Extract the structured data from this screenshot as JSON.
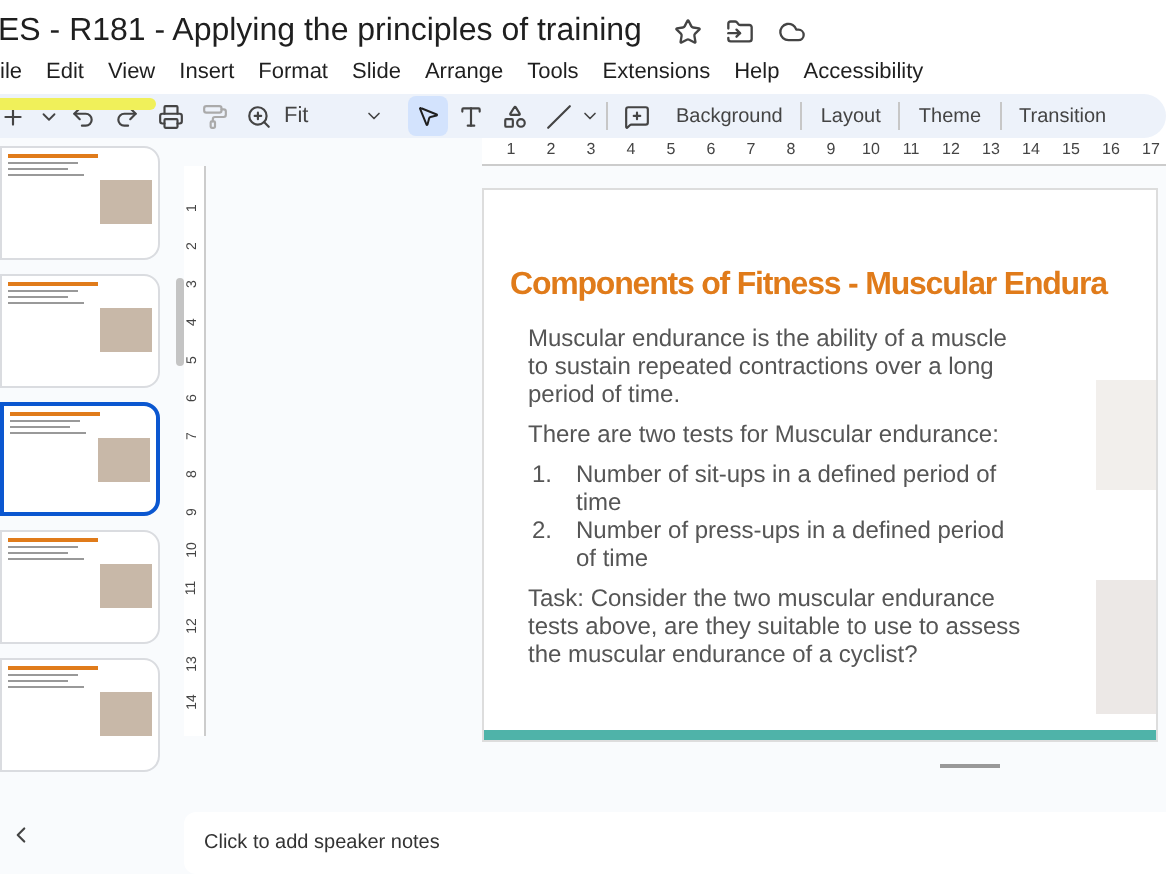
{
  "document": {
    "title": "ES - R181 - Applying the principles of training"
  },
  "menu": [
    "ile",
    "Edit",
    "View",
    "Insert",
    "Format",
    "Slide",
    "Arrange",
    "Tools",
    "Extensions",
    "Help",
    "Accessibility"
  ],
  "toolbar": {
    "zoom": "Fit",
    "buttons": [
      "Background",
      "Layout",
      "Theme",
      "Transition"
    ]
  },
  "thumbnails": [
    {
      "selected": false
    },
    {
      "selected": false
    },
    {
      "selected": true
    },
    {
      "selected": false
    },
    {
      "selected": false
    }
  ],
  "ruler": {
    "horizontal": [
      "1",
      "2",
      "3",
      "4",
      "5",
      "6",
      "7",
      "8",
      "9",
      "10",
      "11",
      "12",
      "13",
      "14",
      "15",
      "16",
      "17"
    ],
    "vertical": [
      "1",
      "2",
      "3",
      "4",
      "5",
      "6",
      "7",
      "8",
      "9",
      "10",
      "11",
      "12",
      "13",
      "14"
    ]
  },
  "slide": {
    "title": "Components of Fitness - Muscular Endura",
    "intro": "Muscular endurance is the ability of a muscle to sustain repeated contractions over a long period of time.",
    "tests_heading": "There are two tests for Muscular endurance:",
    "tests": [
      {
        "number": "1.",
        "text": "Number of sit-ups in a defined period of time"
      },
      {
        "number": "2.",
        "text": "Number of press-ups in a defined period of time"
      }
    ],
    "task": "Task: Consider the two muscular endurance tests above, are they suitable to use to assess the muscular endurance of a cyclist?"
  },
  "speaker_notes": {
    "placeholder": "Click to add speaker notes"
  }
}
